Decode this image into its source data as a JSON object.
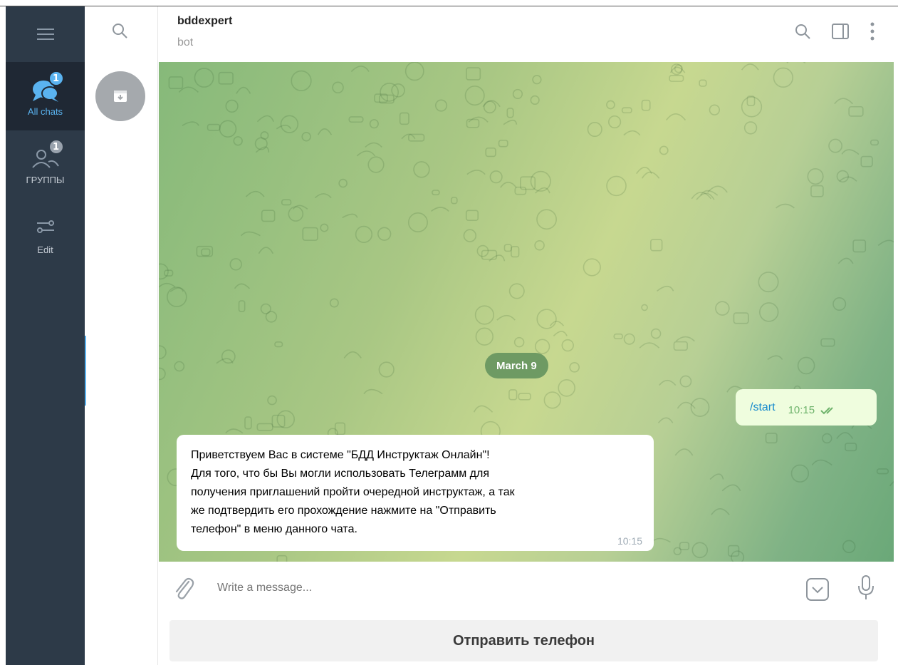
{
  "sidebar": {
    "menu_icon": "hamburger-icon",
    "folders": [
      {
        "label": "All chats",
        "icon": "chats-icon",
        "badge": "1",
        "active": true
      },
      {
        "label": "ГРУППЫ",
        "icon": "groups-icon",
        "badge": "1",
        "active": false
      },
      {
        "label": "Edit",
        "icon": "sliders-icon",
        "badge": "",
        "active": false
      }
    ]
  },
  "chatlist": {
    "search_icon": "search-icon",
    "archive_icon": "archive-icon"
  },
  "header": {
    "title": "bddexpert",
    "subtitle": "bot",
    "icons": [
      "search-icon",
      "sidebar-toggle-icon",
      "more-vertical-icon"
    ]
  },
  "chat": {
    "date_pill": "March 9",
    "outgoing": {
      "text": "/start",
      "time": "10:15",
      "status": "read"
    },
    "incoming": {
      "text": "Приветствуем Вас в системе \"БДД Инструктаж Онлайн\"!\nДля того, что бы Вы могли использовать Телеграмм для\nполучения приглашений пройти очередной инструктаж, а так\nже подтвердить его прохождение нажмите на \"Отправить\nтелефон\" в меню данного чата.",
      "time": "10:15"
    }
  },
  "composer": {
    "placeholder": "Write a message..."
  },
  "reply_keyboard": {
    "button_label": "Отправить телефон"
  },
  "colors": {
    "sidebar_bg": "#2d3a48",
    "accent": "#5ab3f0",
    "outgoing_bg": "#effdde"
  }
}
